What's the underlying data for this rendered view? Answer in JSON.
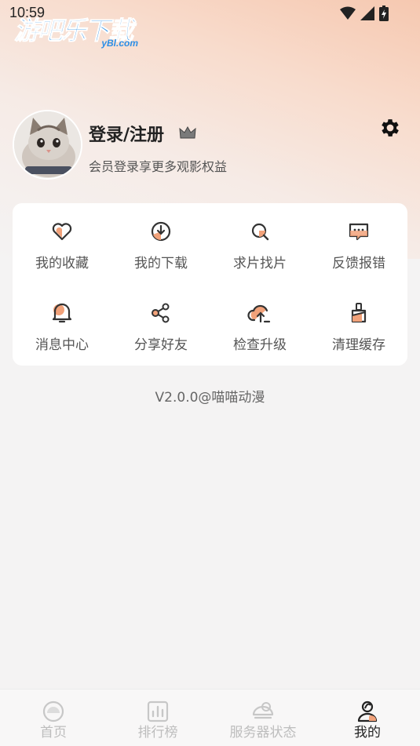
{
  "status_bar": {
    "time": "10:59"
  },
  "watermark": {
    "main": "游吧乐下载",
    "sub": "yBl.com"
  },
  "profile": {
    "title": "登录/注册",
    "subtitle": "会员登录享更多观影权益"
  },
  "menu": {
    "items": [
      {
        "label": "我的收藏",
        "icon": "heart-icon"
      },
      {
        "label": "我的下载",
        "icon": "download-icon"
      },
      {
        "label": "求片找片",
        "icon": "search-icon"
      },
      {
        "label": "反馈报错",
        "icon": "feedback-icon"
      },
      {
        "label": "消息中心",
        "icon": "bell-icon"
      },
      {
        "label": "分享好友",
        "icon": "share-icon"
      },
      {
        "label": "检查升级",
        "icon": "cloud-upload-icon"
      },
      {
        "label": "清理缓存",
        "icon": "brush-icon"
      }
    ]
  },
  "version": "V2.0.0@喵喵动漫",
  "tabbar": {
    "tabs": [
      {
        "label": "首页",
        "icon": "home-icon"
      },
      {
        "label": "排行榜",
        "icon": "ranking-icon"
      },
      {
        "label": "服务器状态",
        "icon": "server-icon"
      },
      {
        "label": "我的",
        "icon": "profile-icon"
      }
    ],
    "active": "我的"
  },
  "colors": {
    "accent": "#f2a27a",
    "icon_stroke": "#333333",
    "tab_inactive": "#bdbdbd"
  }
}
